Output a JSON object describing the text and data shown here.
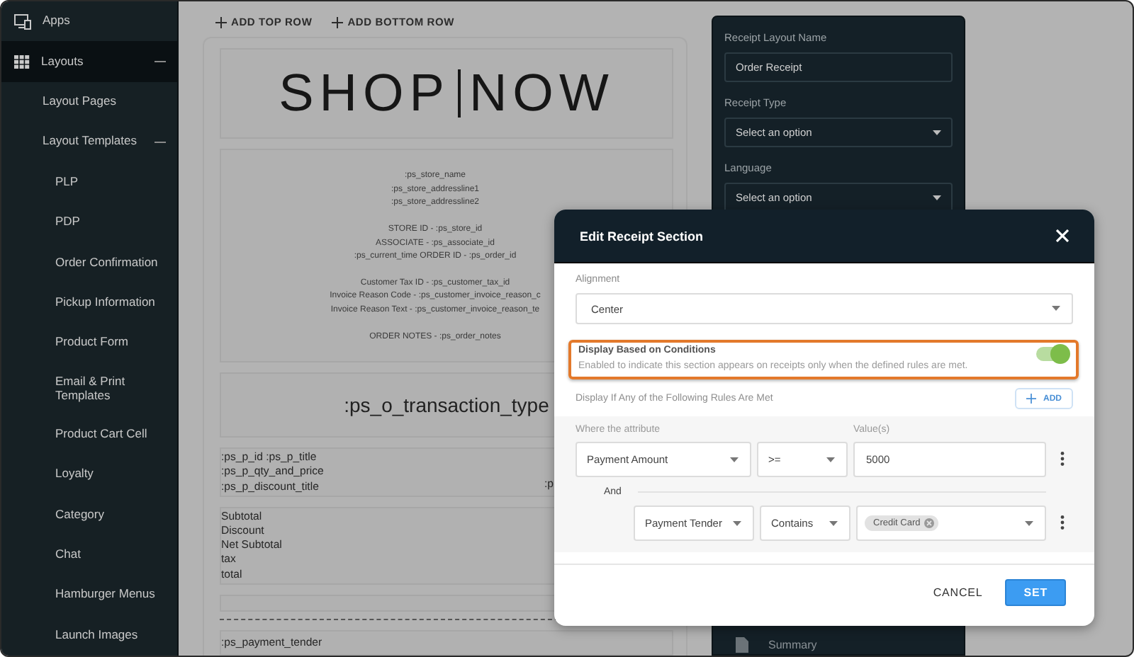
{
  "sidebar": {
    "items": [
      {
        "label": "Apps",
        "selected": false
      },
      {
        "label": "Layouts",
        "expanded": true,
        "selected": true,
        "children": [
          {
            "label": "Layout Pages"
          },
          {
            "label": "Layout Templates",
            "expanded": true,
            "children": [
              {
                "label": "PLP"
              },
              {
                "label": "PDP"
              },
              {
                "label": "Order Confirmation"
              },
              {
                "label": "Pickup Information"
              },
              {
                "label": "Product Form"
              },
              {
                "label": "Email & Print Templates"
              },
              {
                "label": "Product Cart Cell"
              },
              {
                "label": "Loyalty"
              },
              {
                "label": "Category"
              },
              {
                "label": "Chat"
              },
              {
                "label": "Hamburger Menus"
              },
              {
                "label": "Launch Images"
              }
            ]
          }
        ]
      }
    ]
  },
  "toolbar": [
    "ADD TOP ROW",
    "ADD BOTTOM ROW"
  ],
  "receipt": {
    "logo": {
      "left": "SHOP",
      "right": "NOW"
    },
    "header_groups": [
      [
        ":ps_store_name",
        ":ps_store_addressline1",
        ":ps_store_addressline2"
      ],
      [
        "STORE ID - :ps_store_id",
        "ASSOCIATE - :ps_associate_id",
        ":ps_current_time ORDER ID - :ps_order_id"
      ],
      [
        "Customer Tax ID - :ps_customer_tax_id",
        "Invoice Reason Code - :ps_customer_invoice_reason_c",
        "Invoice Reason Text - :ps_customer_invoice_reason_te"
      ],
      [
        "ORDER NOTES - :ps_order_notes"
      ]
    ],
    "transaction_type": ":ps_o_transaction_type",
    "item_lines": [
      ":ps_p_id :ps_p_title",
      ":ps_p_qty_and_price",
      ":ps_p_discount_title"
    ],
    "item_right": ":p",
    "totals": [
      "Subtotal",
      "Discount",
      "Net Subtotal",
      "tax",
      "total"
    ],
    "payment_tender": ":ps_payment_tender"
  },
  "settings_panel": {
    "fields": [
      {
        "label": "Receipt Layout Name",
        "kind": "input",
        "value": "Order Receipt"
      },
      {
        "label": "Receipt Type",
        "kind": "select",
        "value": "Select an option"
      },
      {
        "label": "Language",
        "kind": "select",
        "value": "Select an option"
      }
    ],
    "nav_item": "Summary"
  },
  "dialog": {
    "title": "Edit Receipt Section",
    "alignment": {
      "label": "Alignment",
      "value": "Center"
    },
    "conditions": {
      "title": "Display Based on Conditions",
      "description": "Enabled to indicate this section appears on receipts only when the defined rules are met.",
      "on": true
    },
    "rules_heading": "Display If Any of the Following Rules Are Met",
    "add_button": "ADD",
    "attribute_label": "Where the attribute",
    "values_label": "Value(s)",
    "rules": [
      {
        "attribute": "Payment Amount",
        "operator": ">=",
        "kind": "input",
        "value": "5000"
      },
      {
        "connector": "And",
        "attribute": "Payment Tender",
        "operator": "Contains",
        "kind": "chips",
        "chips": [
          "Credit Card"
        ]
      }
    ],
    "buttons": [
      {
        "label": "CANCEL",
        "kind": "text"
      },
      {
        "label": "SET",
        "kind": "primary"
      }
    ]
  }
}
